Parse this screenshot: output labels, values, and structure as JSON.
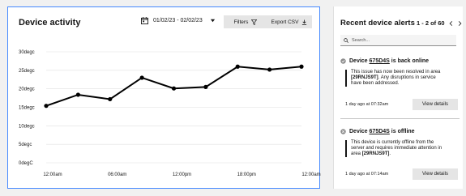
{
  "activity": {
    "title": "Device activity",
    "date_range": "01/02/23 - 02/02/23",
    "filters_label": "Filters",
    "export_label": "Export CSV"
  },
  "alerts": {
    "title": "Recent device alerts",
    "pagination": "1 - 2 of 60",
    "search_placeholder": "Search...",
    "items": [
      {
        "status": "online",
        "prefix": "Device",
        "device_id": "675D4S",
        "status_text": "is back online",
        "message_a": "This issue has now been resolved in area ",
        "area": "[29RNJS9T]",
        "message_b": ". Any disruptions in service have been addressed.",
        "time": "1 day ago at 07:32am",
        "action": "View details"
      },
      {
        "status": "offline",
        "prefix": "Device",
        "device_id": "675D4S",
        "status_text": "is offline",
        "message_a": "This device is currently offline from the server and requires immediate attention in area ",
        "area": "[29RNJS9T]",
        "message_b": ".",
        "time": "1 day ago at 07:14am",
        "action": "View details"
      }
    ]
  },
  "chart_data": {
    "type": "line",
    "title": "",
    "xlabel": "",
    "ylabel": "",
    "x": [
      "12:00am",
      "",
      "",
      "06:00am",
      "",
      "",
      "12:00pm",
      "",
      "",
      "18:00pm",
      "",
      "12:00am"
    ],
    "x_tick_labels": [
      "12:00am",
      "06:00am",
      "12:00pm",
      "18:00pm",
      "12:00am"
    ],
    "y_tick_labels": [
      "0degC",
      "5degc",
      "10degc",
      "15degc",
      "20degc",
      "25degc",
      "30degc"
    ],
    "ylim": [
      0,
      30
    ],
    "series": [
      {
        "values": [
          15.4,
          18.4,
          17.2,
          23.0,
          20.1,
          20.5,
          26.0,
          25.2,
          26.0
        ]
      }
    ],
    "x_positions": [
      0,
      2,
      4,
      6,
      8,
      10,
      12,
      14,
      16
    ],
    "x_max": 16,
    "grid": true,
    "line_color": "#000000"
  },
  "colors": {
    "accent": "#4589ff",
    "button": "#e5e5e5"
  }
}
